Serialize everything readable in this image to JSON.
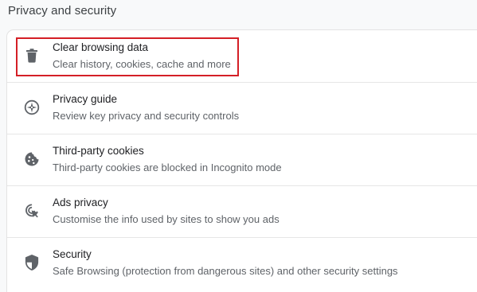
{
  "section": {
    "title": "Privacy and security"
  },
  "items": [
    {
      "label": "Clear browsing data",
      "sub": "Clear history, cookies, cache and more",
      "icon": "trash-icon"
    },
    {
      "label": "Privacy guide",
      "sub": "Review key privacy and security controls",
      "icon": "privacy-guide-icon"
    },
    {
      "label": "Third-party cookies",
      "sub": "Third-party cookies are blocked in Incognito mode",
      "icon": "cookie-icon"
    },
    {
      "label": "Ads privacy",
      "sub": "Customise the info used by sites to show you ads",
      "icon": "ads-privacy-icon"
    },
    {
      "label": "Security",
      "sub": "Safe Browsing (protection from dangerous sites) and other security settings",
      "icon": "shield-icon"
    }
  ],
  "colors": {
    "highlight_border": "#d41f26",
    "icon": "#5f6368"
  }
}
